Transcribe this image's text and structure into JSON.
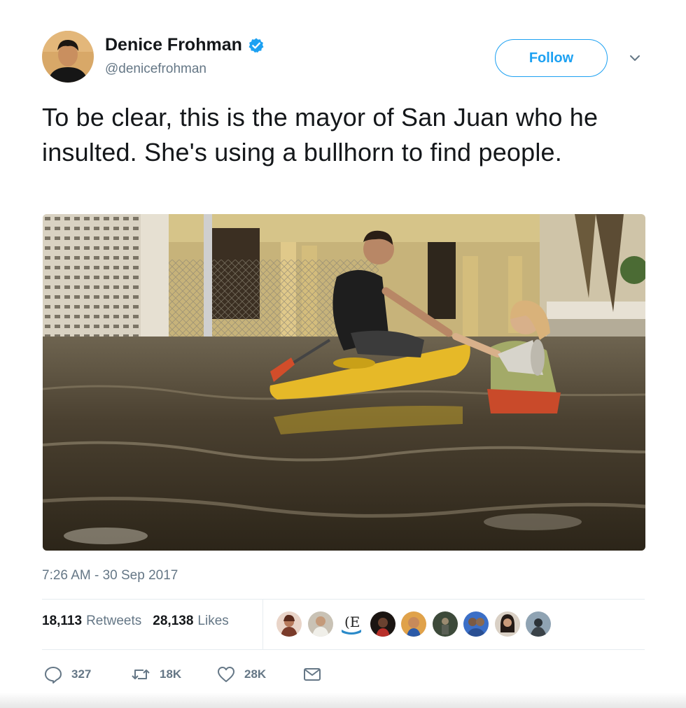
{
  "tweet": {
    "author_name": "Denice Frohman",
    "author_handle": "@denicefrohman",
    "follow_label": "Follow",
    "text": "To be clear, this is the mayor of San Juan who he insulted. She's using a bullhorn to find people.",
    "timestamp": "7:26 AM - 30 Sep 2017"
  },
  "stats": {
    "retweets_count": "18,113",
    "retweets_label": "Retweets",
    "likes_count": "28,138",
    "likes_label": "Likes"
  },
  "actions": {
    "reply_count": "327",
    "retweet_count": "18K",
    "like_count": "28K"
  },
  "icons": {
    "verified": "verified-badge-icon",
    "caret": "chevron-down-icon",
    "reply": "reply-icon",
    "retweet": "retweet-icon",
    "like": "heart-icon",
    "message": "envelope-icon"
  },
  "colors": {
    "accent": "#1da1f2",
    "secondary_text": "#657786",
    "primary_text": "#14171a"
  }
}
